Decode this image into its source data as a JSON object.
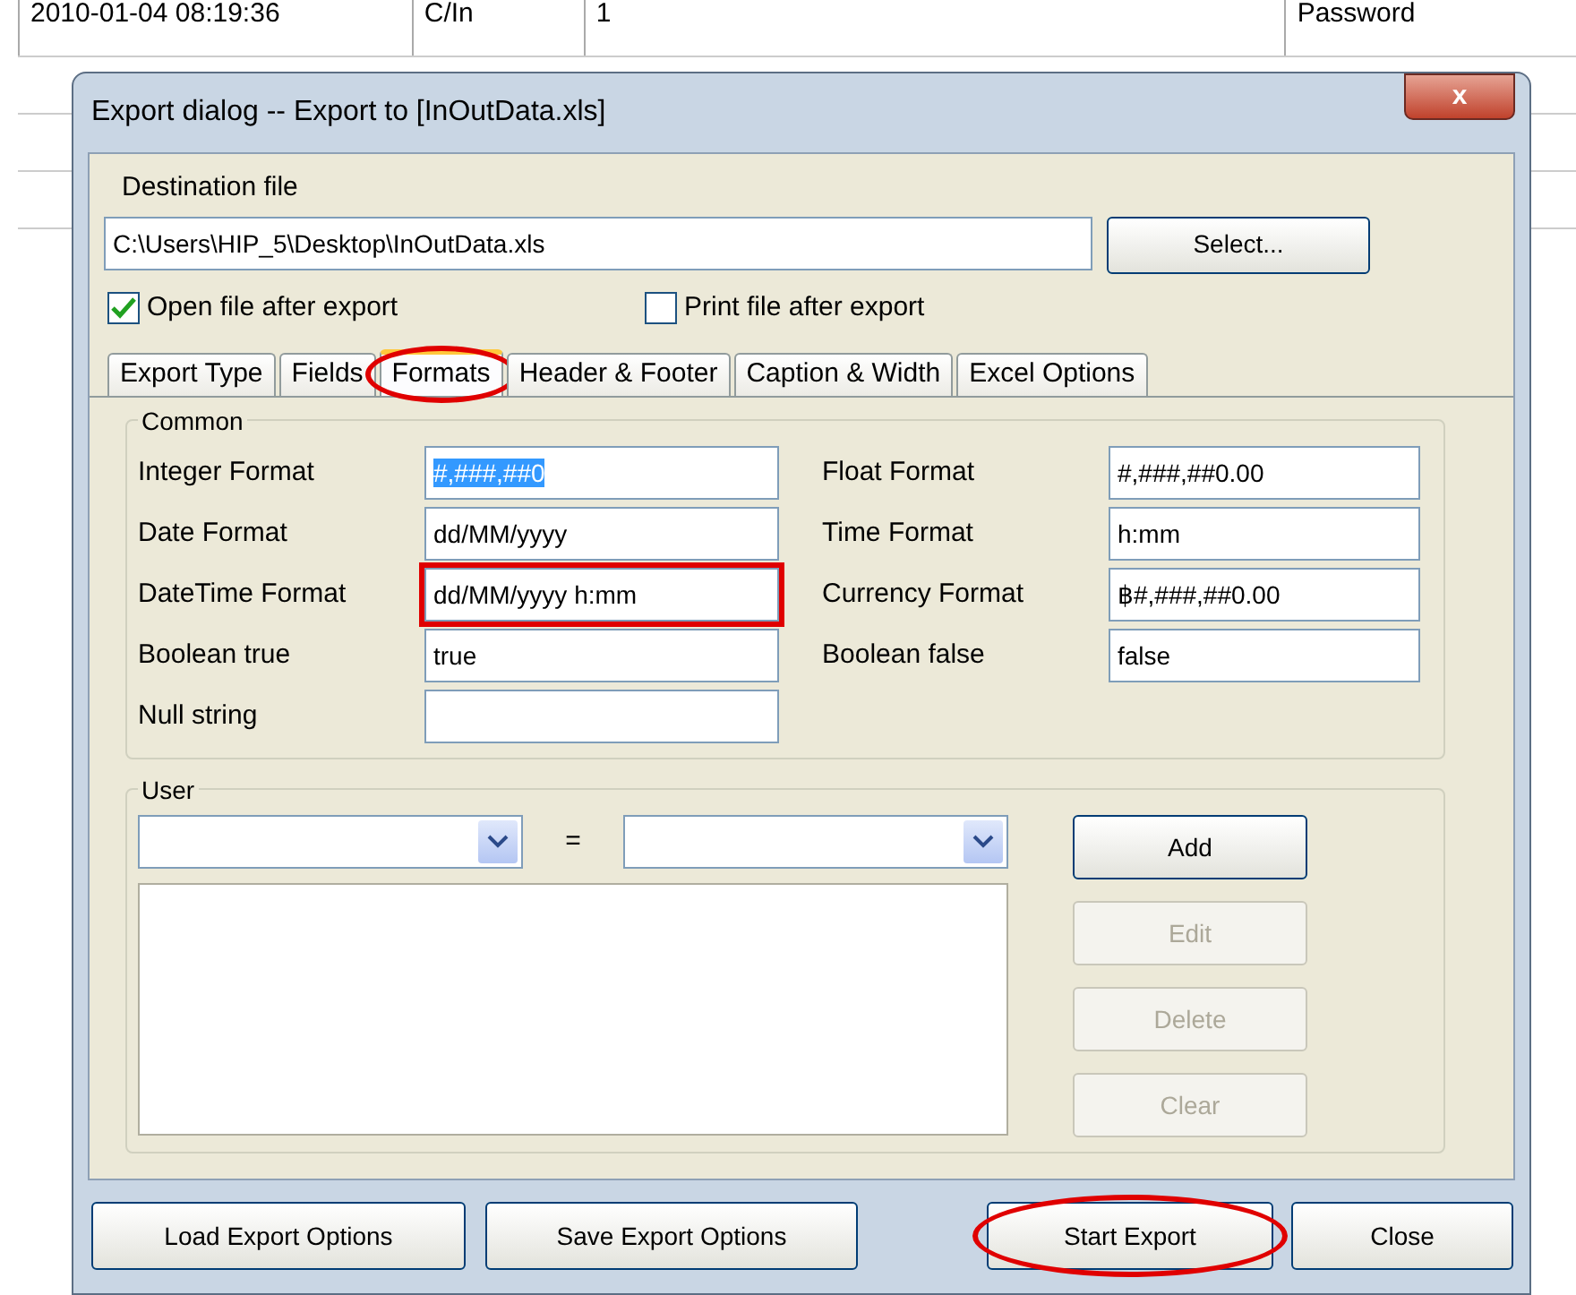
{
  "background_table": {
    "rows": [
      {
        "cells": [
          "2010-01-04 08:19:36",
          "C/In",
          "1",
          "Password"
        ]
      }
    ]
  },
  "window": {
    "title": "Export dialog -- Export to [InOutData.xls]",
    "close_button": "x"
  },
  "destination": {
    "label": "Destination file",
    "value": "C:\\Users\\HIP_5\\Desktop\\InOutData.xls",
    "select_button": "Select..."
  },
  "options": [
    {
      "label": "Open file after export",
      "checked": true
    },
    {
      "label": "Print file after export",
      "checked": false
    }
  ],
  "tabs": [
    {
      "label": "Export Type",
      "selected": false,
      "annotated": false
    },
    {
      "label": "Fields",
      "selected": false,
      "annotated": false
    },
    {
      "label": "Formats",
      "selected": true,
      "annotated": true
    },
    {
      "label": "Header & Footer",
      "selected": false,
      "annotated": false
    },
    {
      "label": "Caption & Width",
      "selected": false,
      "annotated": false
    },
    {
      "label": "Excel Options",
      "selected": false,
      "annotated": false
    }
  ],
  "common": {
    "legend": "Common",
    "fields": [
      {
        "label": "Integer Format",
        "value": "#,###,##0",
        "text_selected": true,
        "annotated": false
      },
      {
        "label": "Float Format",
        "value": "#,###,##0.00",
        "text_selected": false,
        "annotated": false
      },
      {
        "label": "Date Format",
        "value": "dd/MM/yyyy",
        "text_selected": false,
        "annotated": false
      },
      {
        "label": "Time Format",
        "value": "h:mm",
        "text_selected": false,
        "annotated": false
      },
      {
        "label": "DateTime Format",
        "value": "dd/MM/yyyy h:mm",
        "text_selected": false,
        "annotated": true
      },
      {
        "label": "Currency Format",
        "value": "฿#,###,##0.00",
        "text_selected": false,
        "annotated": false
      },
      {
        "label": "Boolean true",
        "value": "true",
        "text_selected": false,
        "annotated": false
      },
      {
        "label": "Boolean false",
        "value": "false",
        "text_selected": false,
        "annotated": false
      },
      {
        "label": "Null string",
        "annotated": false
      }
    ]
  },
  "user": {
    "legend": "User",
    "equals": "=",
    "buttons": [
      {
        "label": "Add",
        "disabled": false
      },
      {
        "label": "Edit",
        "disabled": true
      },
      {
        "label": "Delete",
        "disabled": true
      },
      {
        "label": "Clear",
        "disabled": true
      }
    ]
  },
  "footer_buttons": [
    {
      "label": "Load Export Options",
      "annotated": false
    },
    {
      "label": "Save Export Options",
      "annotated": false
    },
    {
      "label": "Start Export",
      "annotated": true
    },
    {
      "label": "Close",
      "annotated": false
    }
  ]
}
